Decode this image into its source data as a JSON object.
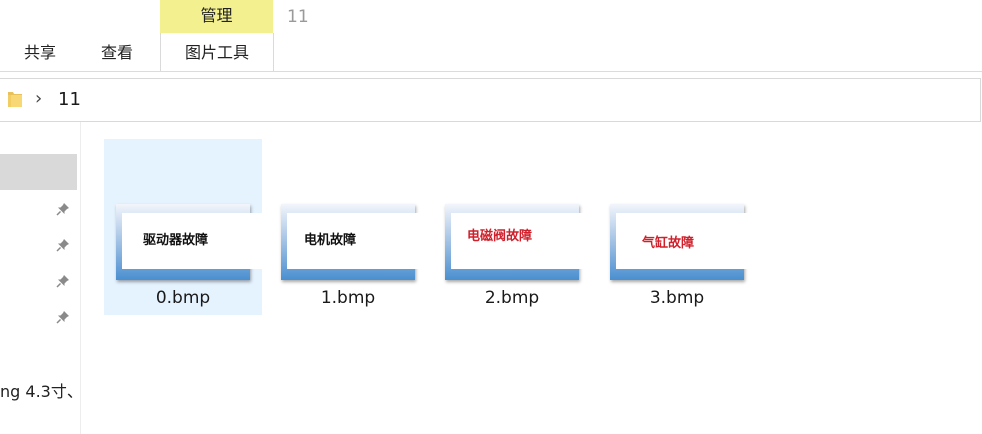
{
  "window": {
    "title": "11"
  },
  "ribbon": {
    "tabs": [
      {
        "label": "共享"
      },
      {
        "label": "查看"
      }
    ],
    "context_group": {
      "header": "管理",
      "tab": "图片工具",
      "color": "#f3f08f"
    }
  },
  "address_bar": {
    "icon": "folder-icon",
    "separator": "›",
    "crumbs": [
      {
        "label": "11"
      }
    ]
  },
  "nav_pane": {
    "pin_icon": "pin-icon",
    "truncated_item": "ng 4.3寸、"
  },
  "files": [
    {
      "name": "0.bmp",
      "thumb_text": "驱动器故障",
      "text_color": "#111111",
      "selected": true
    },
    {
      "name": "1.bmp",
      "thumb_text": "电机故障",
      "text_color": "#111111",
      "selected": false
    },
    {
      "name": "2.bmp",
      "thumb_text": "电磁阀故障",
      "text_color": "#d0202b",
      "selected": false
    },
    {
      "name": "3.bmp",
      "thumb_text": "气缸故障",
      "text_color": "#d0202b",
      "selected": false
    }
  ]
}
